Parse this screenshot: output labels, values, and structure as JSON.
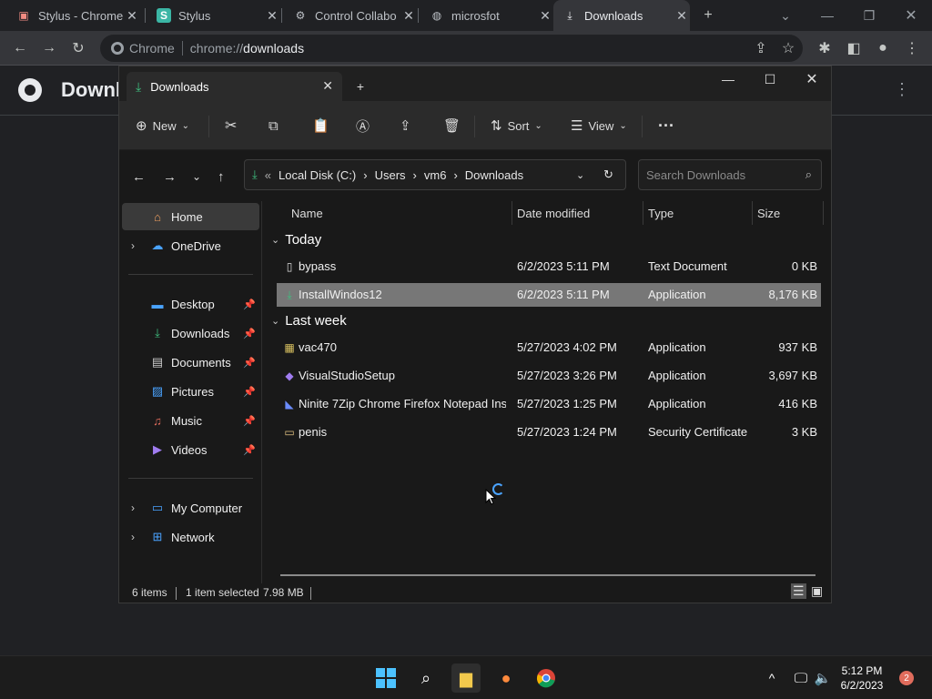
{
  "chrome": {
    "tabs": [
      {
        "label": "Stylus - Chrome",
        "icon": "stylus-store-icon"
      },
      {
        "label": "Stylus",
        "icon": "stylus-icon"
      },
      {
        "label": "Control Collabo",
        "icon": "control-collab-icon"
      },
      {
        "label": "microsfot",
        "icon": "globe-icon"
      },
      {
        "label": "Downloads",
        "icon": "download-icon",
        "active": true
      }
    ],
    "new_tab": "+",
    "omnibox": {
      "chip": "Chrome",
      "scheme": "chrome://",
      "path": "downloads"
    },
    "page_title": "Downloads"
  },
  "explorer": {
    "tab_label": "Downloads",
    "commands": {
      "new": "New",
      "sort": "Sort",
      "view": "View"
    },
    "breadcrumb": [
      "Local Disk (C:)",
      "Users",
      "vm6",
      "Downloads"
    ],
    "search_placeholder": "Search Downloads",
    "nav": {
      "top": [
        {
          "label": "Home",
          "icon": "home-icon"
        },
        {
          "label": "OneDrive",
          "icon": "cloud-icon"
        }
      ],
      "pinned": [
        {
          "label": "Desktop",
          "icon": "desktop-icon"
        },
        {
          "label": "Downloads",
          "icon": "download-icon"
        },
        {
          "label": "Documents",
          "icon": "document-icon"
        },
        {
          "label": "Pictures",
          "icon": "picture-icon"
        },
        {
          "label": "Music",
          "icon": "music-icon"
        },
        {
          "label": "Videos",
          "icon": "video-icon"
        }
      ],
      "bottom": [
        {
          "label": "My Computer",
          "icon": "computer-icon"
        },
        {
          "label": "Network",
          "icon": "network-icon"
        }
      ]
    },
    "columns": {
      "name": "Name",
      "date": "Date modified",
      "type": "Type",
      "size": "Size"
    },
    "groups": [
      {
        "label": "Today",
        "files": [
          {
            "name": "bypass",
            "date": "6/2/2023 5:11 PM",
            "type": "Text Document",
            "size": "0 KB",
            "icon": "text-file-icon"
          },
          {
            "name": "InstallWindos12",
            "date": "6/2/2023 5:11 PM",
            "type": "Application",
            "size": "8,176 KB",
            "icon": "installer-icon",
            "selected": true
          }
        ]
      },
      {
        "label": "Last week",
        "files": [
          {
            "name": "vac470",
            "date": "5/27/2023 4:02 PM",
            "type": "Application",
            "size": "937 KB",
            "icon": "app-icon"
          },
          {
            "name": "VisualStudioSetup",
            "date": "5/27/2023 3:26 PM",
            "type": "Application",
            "size": "3,697 KB",
            "icon": "visual-studio-icon"
          },
          {
            "name": "Ninite 7Zip Chrome Firefox Notepad Inst...",
            "date": "5/27/2023 1:25 PM",
            "type": "Application",
            "size": "416 KB",
            "icon": "ninite-icon"
          },
          {
            "name": "penis",
            "date": "5/27/2023 1:24 PM",
            "type": "Security Certificate",
            "size": "3 KB",
            "icon": "certificate-icon"
          }
        ]
      }
    ],
    "status": {
      "items": "6 items",
      "selected": "1 item selected",
      "size": "7.98 MB"
    }
  },
  "taskbar": {
    "time": "5:12 PM",
    "date": "6/2/2023",
    "notifications": "2"
  }
}
